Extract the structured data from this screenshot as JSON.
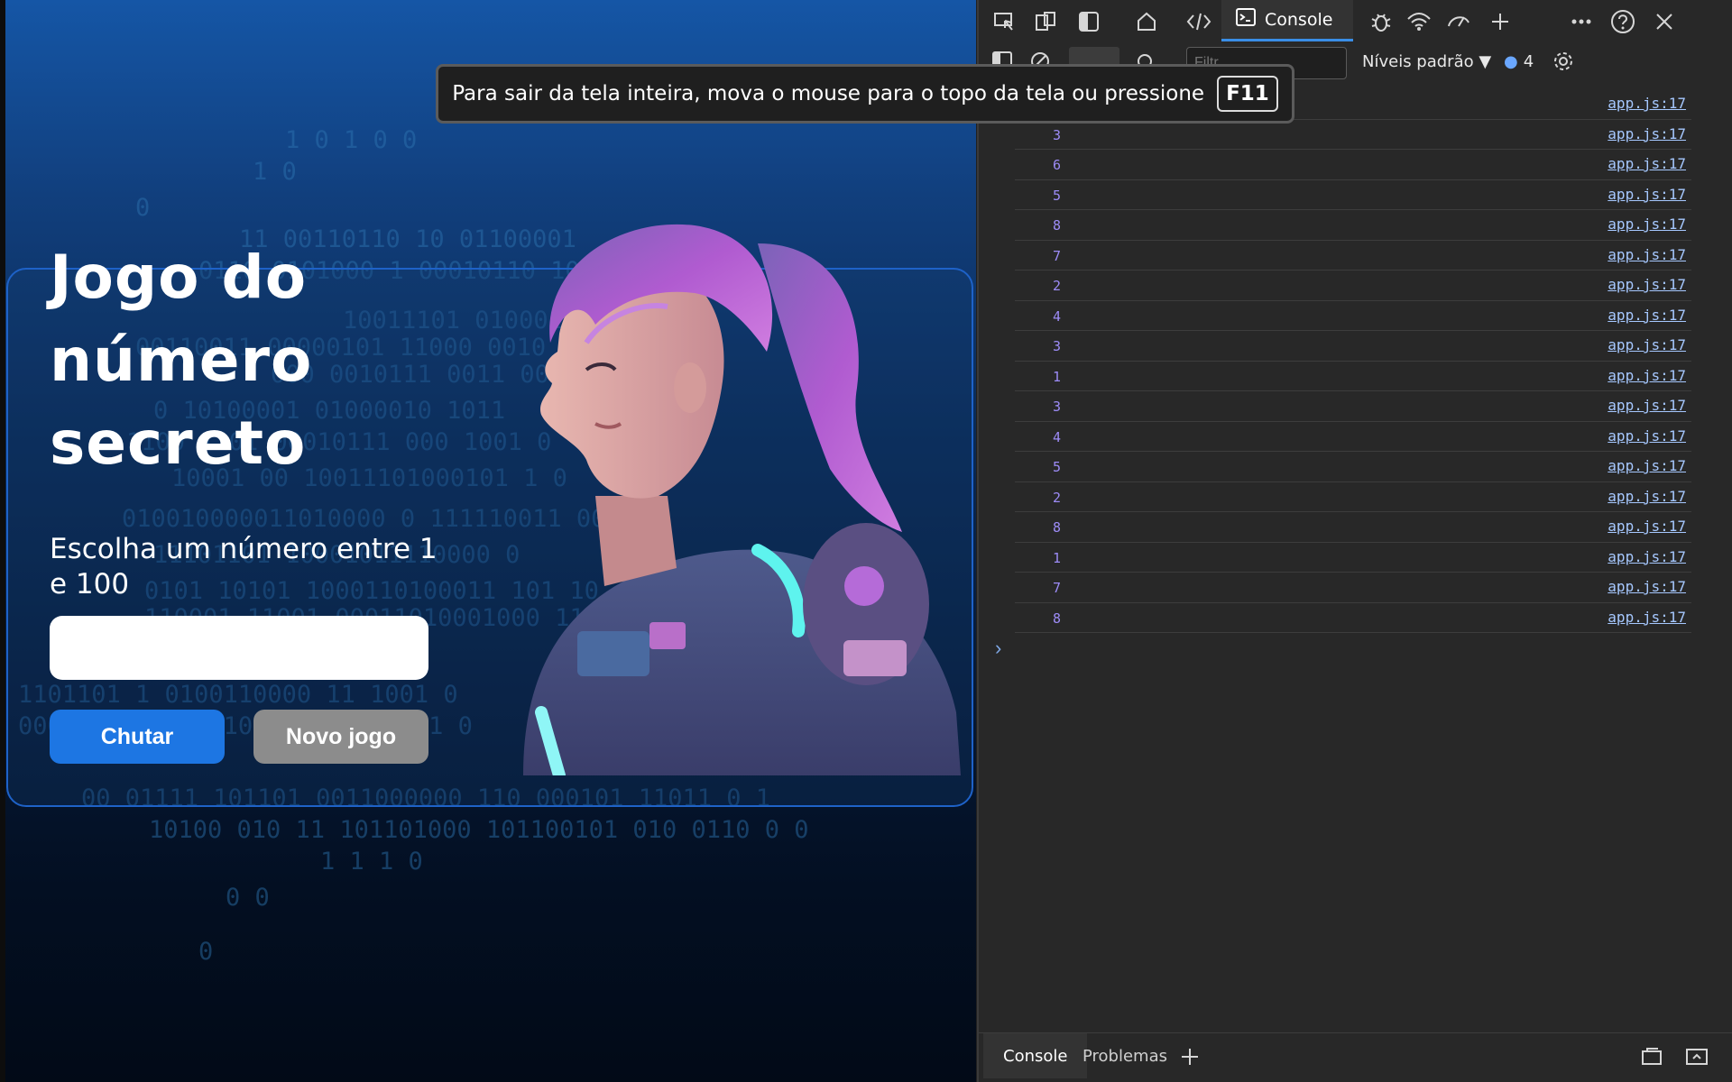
{
  "game": {
    "title": "Jogo do número secreto",
    "subtitle": "Escolha um número entre 1 e 100",
    "input_value": "",
    "guess_button": "Chutar",
    "new_game_button": "Novo jogo",
    "binary_lines": [
      "1  0  1  0  0",
      "1    0",
      "0",
      "11 00110110 10 01100001",
      "0110 0101000 1 00010110  10",
      "10011101 01000101 0  11",
      "00110011 00000101 11000 0010",
      "000 0010111 0011 0011  1 0",
      "0 10100001 01000010  1011",
      "1100 1101 00010111 000 1001  0",
      "10001 00 10011101000101 1 0",
      "010010000011010000 0  111110011 00",
      "11101101 10001011110000 0",
      "0101 10101 1000110100011 101 10",
      "110001 11001 00011010001000 11",
      "1101101 1  0100110000  11 1001 0",
      "00011 00 0 101101 001 01100 1 0",
      "00 01111 101101 0011000000 110 000101 11011 0 1",
      "10100 010 11 101101000 101100101 010 0110 0 0",
      "1      1     1        0",
      "0        0",
      "0"
    ]
  },
  "toast": {
    "message": "Para sair da tela inteira, mova o mouse para o topo da tela ou pressione",
    "key": "F11"
  },
  "devtools": {
    "toolbar_icons": [
      "inspect-icon",
      "device-emulation-icon",
      "dock-icon",
      "welcome-home-icon",
      "elements-icon",
      "console-icon",
      "debug-bug-icon",
      "network-wifi-icon",
      "performance-icon",
      "add-tool-icon",
      "more-icon",
      "help-icon",
      "close-icon"
    ],
    "active_tab": "Console",
    "filter_placeholder": "Filtr",
    "levels_label": "Níveis padrão",
    "message_count": "4",
    "log_source": "app.js:17",
    "log_values": [
      "",
      "3",
      "6",
      "5",
      "8",
      "7",
      "2",
      "4",
      "3",
      "1",
      "3",
      "4",
      "5",
      "2",
      "8",
      "1",
      "7",
      "8"
    ],
    "drawer_tabs": [
      "Console",
      "Problemas"
    ]
  },
  "colors": {
    "accent": "#1d76e3",
    "secondary_button": "#8c8c8c",
    "card_border": "#1e62c8",
    "log_value": "#9d8cf7",
    "log_link": "#a6c8ff"
  }
}
